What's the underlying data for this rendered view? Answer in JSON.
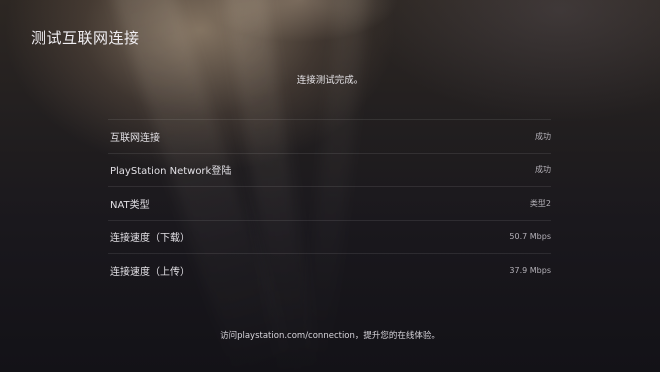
{
  "page": {
    "title": "测试互联网连接",
    "status_message": "连接测试完成。"
  },
  "results": [
    {
      "label": "互联网连接",
      "value": "成功"
    },
    {
      "label": "PlayStation Network登陆",
      "value": "成功"
    },
    {
      "label": "NAT类型",
      "value": "类型2"
    },
    {
      "label": "连接速度（下载）",
      "value": "50.7 Mbps"
    },
    {
      "label": "连接速度（上传）",
      "value": "37.9 Mbps"
    }
  ],
  "footer": {
    "text": "访问playstation.com/connection，提升您的在线体验。"
  }
}
